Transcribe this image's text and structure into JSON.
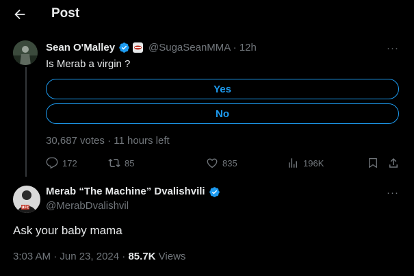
{
  "header": {
    "title": "Post"
  },
  "original_post": {
    "author_name": "Sean O'Malley",
    "handle": "@SugaSeanMMA",
    "separator": "·",
    "time": "12h",
    "more": "···",
    "text": "Is Merab a virgin ?",
    "poll": {
      "options": [
        "Yes",
        "No"
      ],
      "votes": "30,687 votes",
      "separator": "·",
      "time_left": "11 hours left"
    },
    "actions": {
      "replies": "172",
      "reposts": "85",
      "likes": "835",
      "views": "196K"
    }
  },
  "reply_post": {
    "author_name": "Merab “The Machine” Dvalishvili",
    "handle": "@MerabDvalishvil",
    "more": "···",
    "text": "Ask your baby mama",
    "timestamp": "3:03 AM · Jun 23, 2024",
    "separator": "·",
    "views_count": "85.7K",
    "views_label": "Views",
    "avatar_text": "UFC"
  },
  "colors": {
    "background": "#000000",
    "primary_text": "#e7e9ea",
    "secondary_text": "#71767b",
    "accent": "#1d9bf0",
    "thread_line": "#333639"
  },
  "icons": [
    "back-arrow-icon",
    "verified-icon",
    "emblem-icon",
    "more-icon",
    "reply-icon",
    "repost-icon",
    "like-icon",
    "views-icon",
    "bookmark-icon",
    "share-icon"
  ]
}
